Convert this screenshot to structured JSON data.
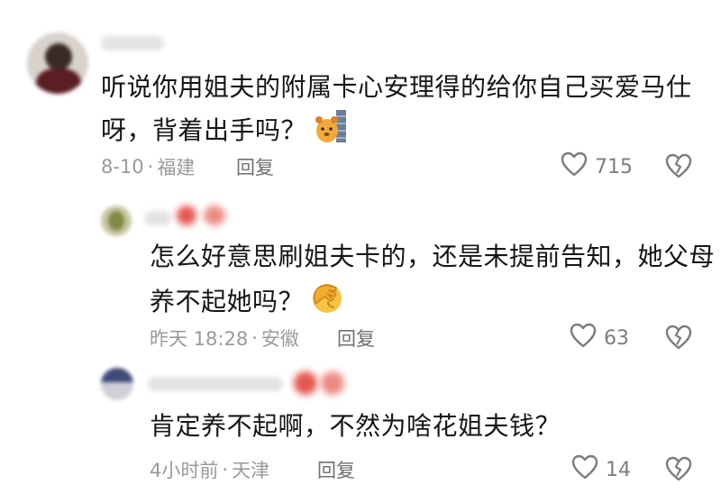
{
  "comments": [
    {
      "text_line1": "听说你用姐夫的附属卡心安理得的给你自己买爱马仕",
      "text_line2": "呀，背着出手吗？",
      "emoji": "dog-hiding-behind-wall",
      "date": "8-10",
      "location": "福建",
      "reply_label": "回复",
      "likes": "715"
    },
    {
      "text_line1": "怎么好意思刷姐夫卡的，还是未提前告知，她父母",
      "text_line2": "养不起她吗？",
      "emoji": "facepalm-face",
      "date": "昨天 18:28",
      "location": "安徽",
      "reply_label": "回复",
      "likes": "63"
    },
    {
      "text_line1": "肯定养不起啊，不然为啥花姐夫钱？",
      "date": "4小时前",
      "location": "天津",
      "reply_label": "回复",
      "likes": "14"
    }
  ],
  "meta_separator": "·",
  "colors": {
    "text": "#161616",
    "meta": "#9a9a9a",
    "icon": "#7d7d7d"
  }
}
